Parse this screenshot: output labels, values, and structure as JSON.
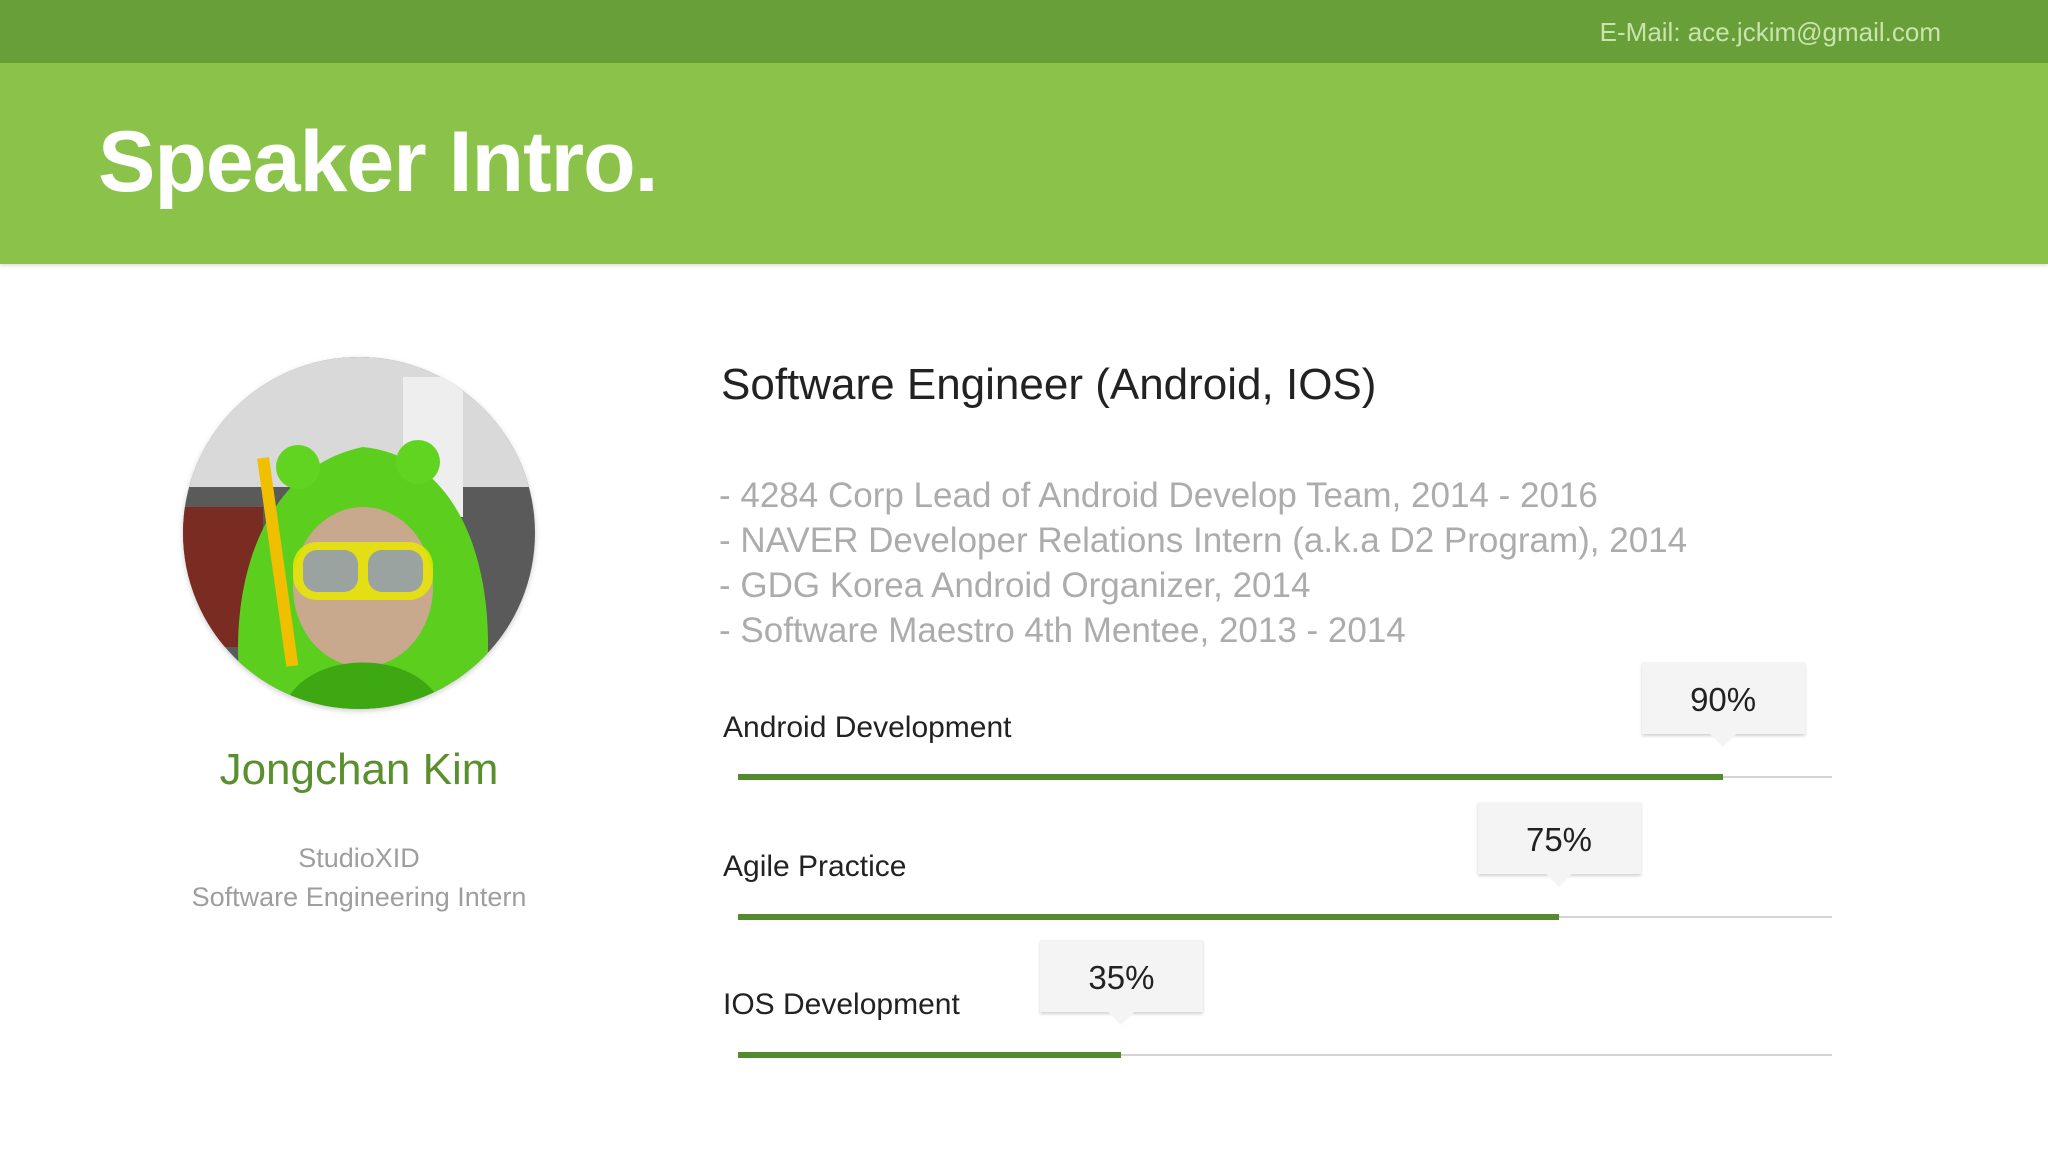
{
  "header": {
    "email": "E-Mail: ace.jckim@gmail.com",
    "title": "Speaker Intro."
  },
  "profile": {
    "name": "Jongchan Kim",
    "company": "StudioXID",
    "position": "Software Engineering Intern"
  },
  "main": {
    "role_title": "Software Engineer (Android, IOS)",
    "bullets": [
      "- 4284 Corp Lead of Android Develop Team, 2014 - 2016",
      "- NAVER Developer Relations Intern (a.k.a D2 Program), 2014",
      "- GDG Korea Android Organizer, 2014",
      "- Software Maestro 4th Mentee, 2013 - 2014"
    ],
    "skills": [
      {
        "label": "Android Development",
        "value": 90,
        "value_label": "90%"
      },
      {
        "label": "Agile Practice",
        "value": 75,
        "value_label": "75%"
      },
      {
        "label": "IOS Development",
        "value": 35,
        "value_label": "35%"
      }
    ]
  },
  "colors": {
    "topbar": "#689f38",
    "header": "#8bc34a",
    "accent": "#558b2f",
    "name": "#5a8f2e"
  }
}
